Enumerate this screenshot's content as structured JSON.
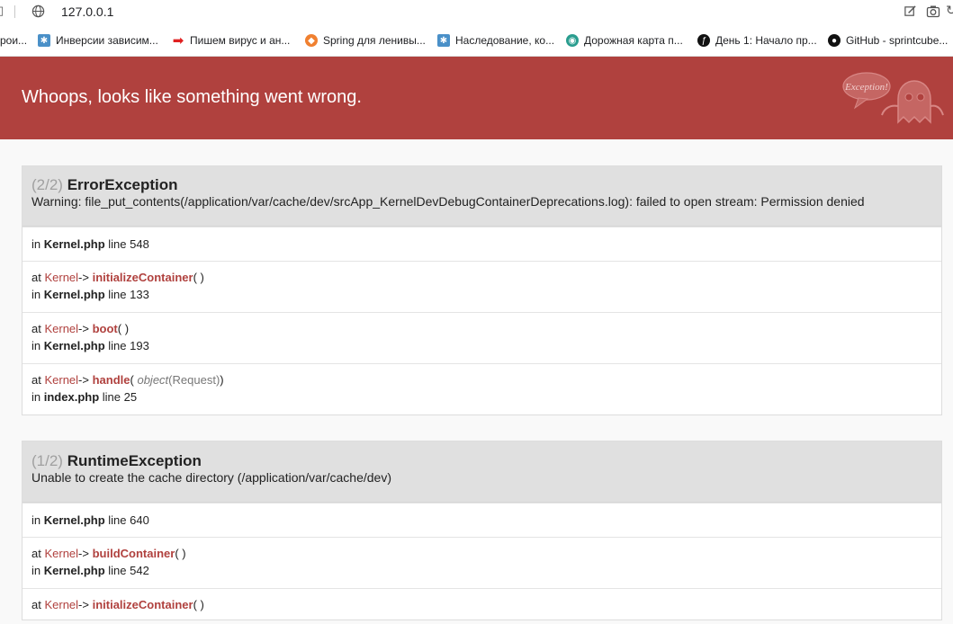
{
  "browser": {
    "url": "127.0.0.1",
    "bookmarks": [
      {
        "label": "рои...",
        "icon": "none",
        "color": "#ffffff"
      },
      {
        "label": "Инверсии зависим...",
        "icon": "gear-icon",
        "color": "#4a90c8"
      },
      {
        "label": "Пишем вирус и ан...",
        "icon": "arrow-right-icon",
        "color": "#e02020"
      },
      {
        "label": "Spring для ленивы...",
        "icon": "shield-icon",
        "color": "#f08030"
      },
      {
        "label": "Наследование, ко...",
        "icon": "gear-icon",
        "color": "#4a90c8"
      },
      {
        "label": "Дорожная карта п...",
        "icon": "globe-icon",
        "color": "#2a9d8f"
      },
      {
        "label": "День 1: Начало пр...",
        "icon": "symfony-icon",
        "color": "#111111"
      },
      {
        "label": "GitHub - sprintcube...",
        "icon": "github-icon",
        "color": "#111111"
      }
    ]
  },
  "header": {
    "title": "Whoops, looks like something went wrong.",
    "mascot_text": "Exception!"
  },
  "exceptions": [
    {
      "count": "(2/2)",
      "name": "ErrorException",
      "message": "Warning: file_put_contents(/application/var/cache/dev/srcApp_KernelDevDebugContainerDeprecations.log): failed to open stream: Permission denied",
      "trace": [
        {
          "file": "Kernel.php",
          "line": "548"
        },
        {
          "cls": "Kernel",
          "arrow": "->",
          "fn": "initializeContainer",
          "args": "",
          "file": "Kernel.php",
          "line": "133"
        },
        {
          "cls": "Kernel",
          "arrow": "->",
          "fn": "boot",
          "args": "",
          "file": "Kernel.php",
          "line": "193"
        },
        {
          "cls": "Kernel",
          "arrow": "->",
          "fn": "handle",
          "args_type": "object",
          "args_class": "Request",
          "file": "index.php",
          "line": "25"
        }
      ]
    },
    {
      "count": "(1/2)",
      "name": "RuntimeException",
      "message": "Unable to create the cache directory (/application/var/cache/dev)",
      "trace": [
        {
          "file": "Kernel.php",
          "line": "640"
        },
        {
          "cls": "Kernel",
          "arrow": "->",
          "fn": "buildContainer",
          "args": "",
          "file": "Kernel.php",
          "line": "542"
        },
        {
          "cls": "Kernel",
          "arrow": "->",
          "fn": "initializeContainer",
          "args": ""
        }
      ]
    }
  ],
  "labels": {
    "in": "in",
    "at": "at",
    "line": "line",
    "open_paren": "(",
    "close_paren": ")"
  },
  "colors": {
    "header_bg": "#b0413e",
    "accent": "#b0413e"
  }
}
